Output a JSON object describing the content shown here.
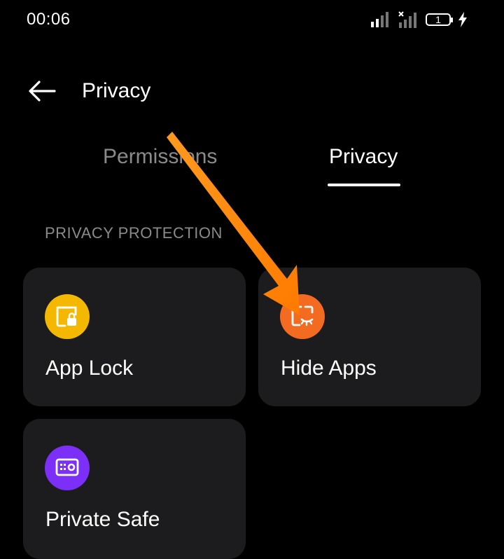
{
  "status_bar": {
    "time": "00:06",
    "battery_level": "1"
  },
  "header": {
    "title": "Privacy"
  },
  "tabs": [
    {
      "label": "Permissions",
      "active": false
    },
    {
      "label": "Privacy",
      "active": true
    }
  ],
  "section": {
    "label": "PRIVACY PROTECTION"
  },
  "cards": [
    {
      "label": "App Lock",
      "icon": "app-lock-icon",
      "color": "#F5B800"
    },
    {
      "label": "Hide Apps",
      "icon": "hide-apps-icon",
      "color": "#F36B21"
    },
    {
      "label": "Private Safe",
      "icon": "private-safe-icon",
      "color": "#7B2FF7"
    }
  ],
  "colors": {
    "background": "#000000",
    "card": "#1C1C1E",
    "annotation_arrow": "#FF8A00"
  }
}
